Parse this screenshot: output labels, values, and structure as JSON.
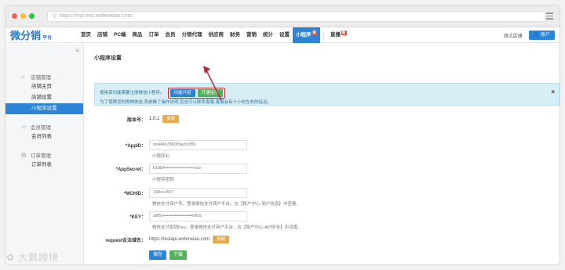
{
  "browser": {
    "url": "https://mp.test.wxfenxiao.com",
    "dot_colors": [
      "#ff5f57",
      "#febc2e",
      "#28c840"
    ]
  },
  "logo": {
    "main": "微分销",
    "sub": "平台"
  },
  "nav": {
    "items": [
      "首页",
      "店铺",
      "PC端",
      "商品",
      "订单",
      "会员",
      "分销代理",
      "供应商",
      "财务",
      "营销",
      "统计",
      "设置"
    ],
    "active": "小程序",
    "active_badge": "新",
    "extra": "直播",
    "extra_badge": "新"
  },
  "topright": {
    "shop": "测试店铺",
    "user": "账户"
  },
  "sidebar": {
    "groups": [
      {
        "title": "店铺管理",
        "icon": "home-icon",
        "items": [
          "店铺主页",
          "店铺设置",
          "小程序设置"
        ]
      },
      {
        "title": "会员管理",
        "icon": "user-icon",
        "items": [
          "会员列表"
        ]
      },
      {
        "title": "订单管理",
        "icon": "order-icon",
        "items": [
          "订单列表"
        ]
      }
    ]
  },
  "main": {
    "title": "小程序设置",
    "notice": {
      "line1": "使用该功能需要注册微信小程序。",
      "btn_intro": "功能介绍",
      "btn_guide": "开通指引",
      "line2": "为了保障您的购物体验,系统推了操作说明,您也可以联系客服,客服会有十小时左右的延迟。"
    },
    "version": {
      "label": "版本号：",
      "value": "1.0.1",
      "btn": "复制"
    },
    "appid": {
      "label": "*AppID：",
      "value": "wx4f4d78b0f3aeb1f09",
      "hint": "小程序ID"
    },
    "appsecret": {
      "label": "*AppSecret：",
      "value": "b1dbf••••••••••••••••••••ccb",
      "hint": "小程序密钥"
    },
    "mchid": {
      "label": "*MCHID：",
      "value": "148••••557",
      "hint": "微信支付商户号，登录微信支付商户平台，在【账户中心-商户信息】中查看。"
    },
    "key": {
      "label": "*KEY：",
      "value": "a8f5e•••••••••••••••••••e9cb",
      "hint": "微信支付密钥Key，登录微信支付商户平台，在【账户中心-API安全】中设置。"
    },
    "request": {
      "label": "request合法域名：",
      "value": "https://testapi.wxfenxiao.com",
      "btn": "复制"
    },
    "save": "保存",
    "download": "下载"
  },
  "watermark": "大数跨境"
}
